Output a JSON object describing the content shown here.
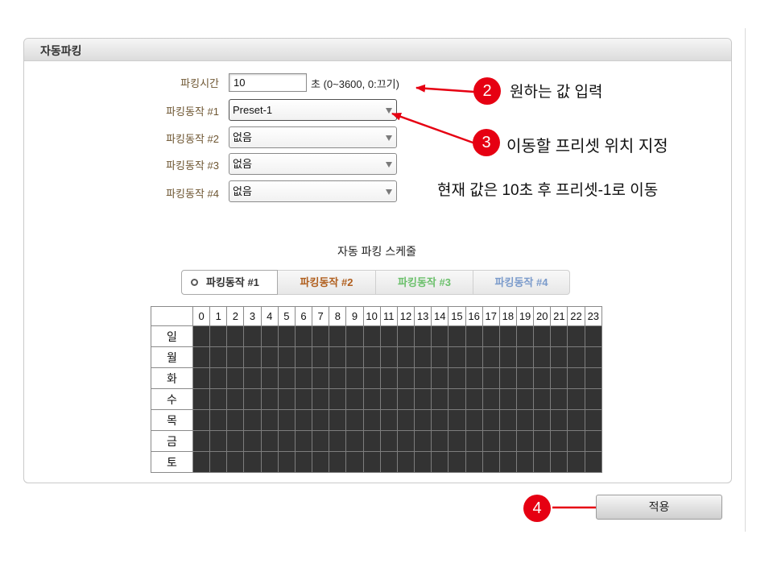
{
  "panel": {
    "title": "자동파킹"
  },
  "form": {
    "parking_time": {
      "label": "파킹시간",
      "value": "10",
      "hint": "초 (0~3600, 0:끄기)"
    },
    "actions": [
      {
        "label": "파킹동작 #1",
        "value": "Preset-1"
      },
      {
        "label": "파킹동작 #2",
        "value": "없음"
      },
      {
        "label": "파킹동작 #3",
        "value": "없음"
      },
      {
        "label": "파킹동작 #4",
        "value": "없음"
      }
    ]
  },
  "callouts": [
    {
      "number": "2",
      "text": "원하는 값 입력"
    },
    {
      "number": "3",
      "text": "이동할 프리셋 위치 지정"
    },
    {
      "number": "4"
    }
  ],
  "note": "현재 값은 10초 후 프리셋-1로 이동",
  "schedule": {
    "title": "자동 파킹 스케줄",
    "tabs": [
      {
        "label": "파킹동작 #1",
        "color": "#333333",
        "selected": true
      },
      {
        "label": "파킹동작 #2",
        "color": "#b05f1e",
        "selected": false
      },
      {
        "label": "파킹동작 #3",
        "color": "#6cc06c",
        "selected": false
      },
      {
        "label": "파킹동작 #4",
        "color": "#7b9bcb",
        "selected": false
      }
    ],
    "hours": [
      "0",
      "1",
      "2",
      "3",
      "4",
      "5",
      "6",
      "7",
      "8",
      "9",
      "10",
      "11",
      "12",
      "13",
      "14",
      "15",
      "16",
      "17",
      "18",
      "19",
      "20",
      "21",
      "22",
      "23"
    ],
    "days": [
      "일",
      "월",
      "화",
      "수",
      "목",
      "금",
      "토"
    ]
  },
  "apply_button": {
    "label": "적용"
  },
  "colors": {
    "callout_red": "#e60012",
    "field_label": "#6e5632",
    "schedule_cell": "#333333"
  },
  "icons": {
    "tab_selected": "radio-selected-icon",
    "dropdown": "dropdown-arrow-icon"
  }
}
